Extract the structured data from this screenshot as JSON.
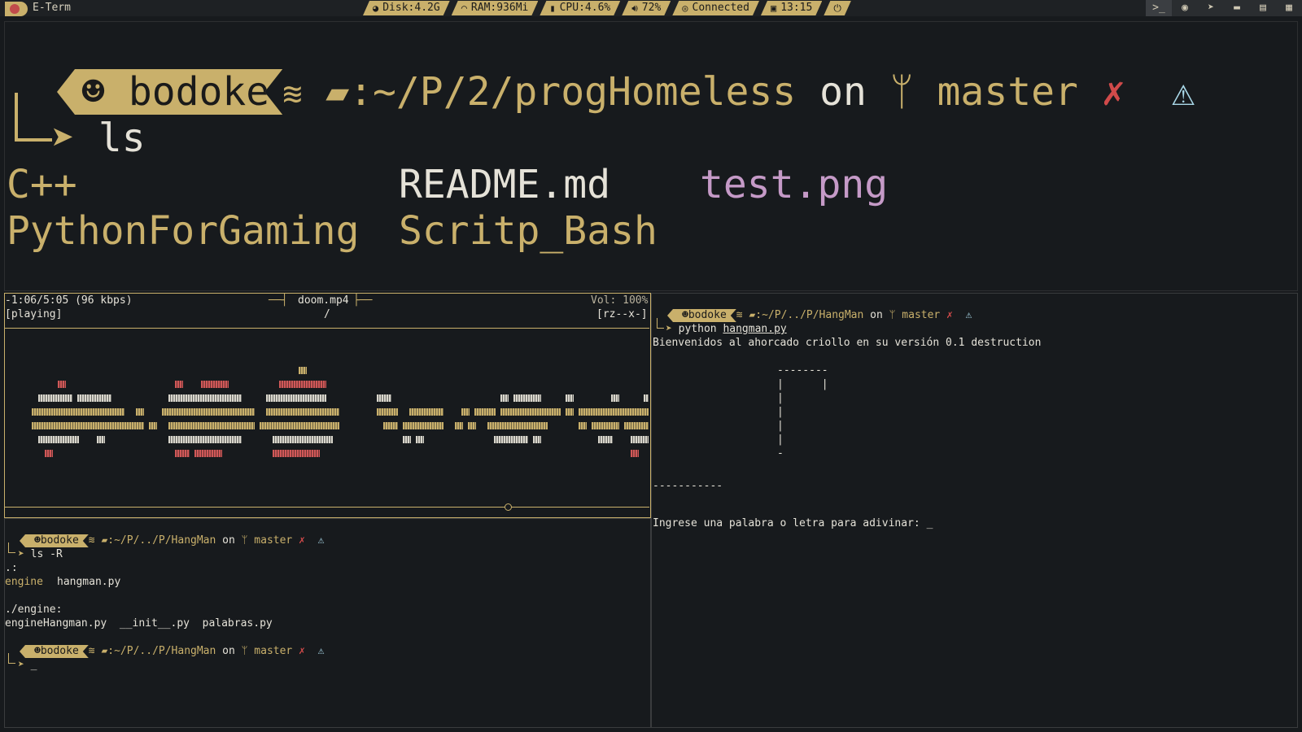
{
  "topbar": {
    "app_title": "E-Term",
    "status": [
      {
        "icon": "disk-icon",
        "text": "Disk:4.2G"
      },
      {
        "icon": "ram-gauge-icon",
        "text": "RAM:936Mi"
      },
      {
        "icon": "cpu-icon",
        "text": "CPU:4.6%"
      },
      {
        "icon": "volume-icon",
        "text": "72%"
      },
      {
        "icon": "wifi-icon",
        "text": "Connected"
      },
      {
        "icon": "calendar-icon",
        "text": "13:15"
      },
      {
        "icon": "power-icon",
        "text": ""
      }
    ],
    "tray": [
      "terminal-icon",
      "firefox-icon",
      "telegram-icon",
      "folder-icon",
      "document-icon",
      "film-icon"
    ]
  },
  "main_pane": {
    "user": "bodoke",
    "path": ":~/P/2/progHomeless",
    "on": "on",
    "branch": "master",
    "dirty_mark": "✗",
    "warn_mark": "⚠",
    "command": "ls",
    "files": {
      "c1": "C++",
      "c2": "README.md",
      "c3": "test.png",
      "c4": "PythonForGaming",
      "c5": "Scritp_Bash"
    }
  },
  "mpv": {
    "time": "-1:06/5:05 (96 kbps)",
    "state": "[playing]",
    "title": "doom.mp4",
    "slash": "/",
    "volume": "Vol: 100%",
    "flags": "[rz--x-]",
    "progress_fraction": 0.78
  },
  "bottom_left": {
    "prompt1": {
      "user": "bodoke",
      "path": ":~/P/../P/HangMan",
      "on": "on",
      "branch": "master",
      "dirty": "✗",
      "warn": "⚠"
    },
    "command": "ls -R",
    "out_dot": ".:",
    "out_engine": "engine",
    "out_hangman": "hangman.py",
    "out_engine_dir": "./engine:",
    "out_engine_files": "engineHangman.py  __init__.py  palabras.py",
    "prompt2": {
      "user": "bodoke",
      "path": ":~/P/../P/HangMan",
      "on": "on",
      "branch": "master",
      "dirty": "✗",
      "warn": "⚠"
    },
    "cursor": "_"
  },
  "bottom_right": {
    "prompt": {
      "user": "bodoke",
      "path": ":~/P/../P/HangMan",
      "on": "on",
      "branch": "master",
      "dirty": "✗",
      "warn": "⚠"
    },
    "command": "python",
    "command_arg": "hangman.py",
    "welcome": "Bienvenidos al ahorcado criollo en su versión 0.1 destruction",
    "gallows": "--------\n|      |\n|\n|\n|\n|\n-",
    "dashes": "-----------",
    "question": "Ingrese una palabra o letra para adivinar:",
    "cursor": "_"
  }
}
